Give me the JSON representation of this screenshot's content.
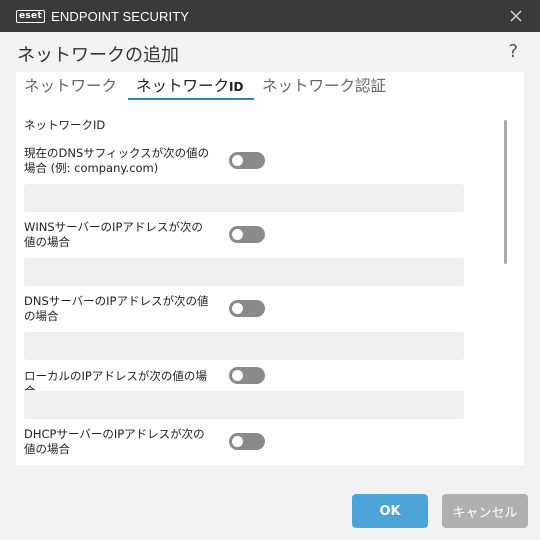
{
  "app": {
    "brand_mark": "eset",
    "brand_name": "ENDPOINT SECURITY"
  },
  "dialog": {
    "title": "ネットワークの追加",
    "help_label": "?"
  },
  "tabs": [
    {
      "label": "ネットワーク",
      "active": false
    },
    {
      "label": "ネットワーク",
      "label_suffix": "ID",
      "active": true
    },
    {
      "label": "ネットワーク認証",
      "active": false
    }
  ],
  "section": {
    "title": "ネットワークID"
  },
  "rows": [
    {
      "label": "現在のDNSサフィックスが次の値の場合 (例: company.com)",
      "enabled": false,
      "value": ""
    },
    {
      "label": "WINSサーバーのIPアドレスが次の値の場合",
      "enabled": false,
      "value": ""
    },
    {
      "label": "DNSサーバーのIPアドレスが次の値の場合",
      "enabled": false,
      "value": ""
    },
    {
      "label": "ローカルのIPアドレスが次の値の場合",
      "enabled": false,
      "value": ""
    },
    {
      "label": "DHCPサーバーのIPアドレスが次の値の場合",
      "enabled": false,
      "value": ""
    }
  ],
  "buttons": {
    "ok": "OK",
    "cancel": "キャンセル"
  },
  "colors": {
    "titlebar": "#3a3a3a",
    "accent": "#2c84b5",
    "ok_button": "#4ca3d8",
    "cancel_button": "#b0b0b0",
    "toggle_off": "#8a8a8a"
  }
}
